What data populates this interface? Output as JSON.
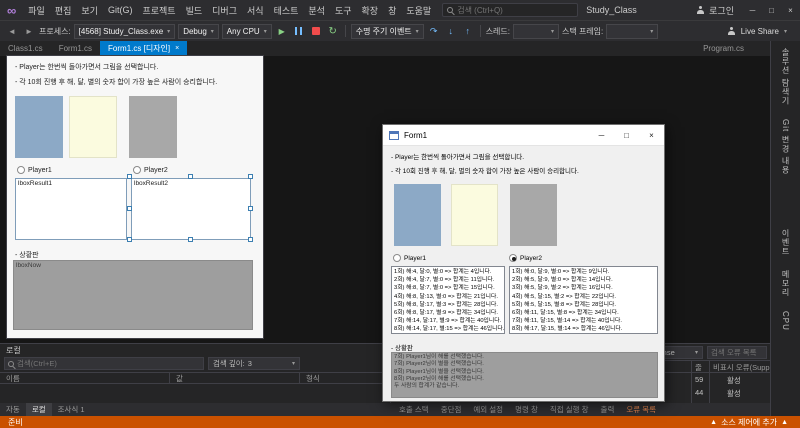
{
  "colors": {
    "accent": "#007acc",
    "status_bar": "#ca5100",
    "picture_blue": "#8ca9c6",
    "picture_cream": "#fbfbdf",
    "picture_gray": "#a8a8a8"
  },
  "titlebar": {
    "menus": [
      "파일",
      "편집",
      "보기",
      "Git(G)",
      "프로젝트",
      "빌드",
      "디버그",
      "서식",
      "테스트",
      "분석",
      "도구",
      "확장",
      "창",
      "도움말"
    ],
    "search_placeholder": "검색 (Ctrl+Q)",
    "solution": "Study_Class",
    "sign_in": "로그인",
    "minimize": "─",
    "maximize": "□",
    "close": "×"
  },
  "toolbar": {
    "back": "◄",
    "forward": "►",
    "process_label": "프로세스:",
    "process_value": "[4568] Study_Class.exe",
    "config": "Debug",
    "platform": "Any CPU",
    "continue_icon": "▶",
    "restart_icon": "↻",
    "lifecycle": "수명 주기 이벤트",
    "step_over": "↷",
    "step_into": "↓",
    "step_out": "↑",
    "thread_label": "스레드:",
    "frame_label": "스택 프레임:",
    "live_share": "Live Share",
    "caret": "▾"
  },
  "doc_tabs": {
    "tab1": "Class1.cs",
    "tab2": "Form1.cs",
    "tab3": "Form1.cs [디자인]",
    "tab4": "Program.cs",
    "close": "×"
  },
  "form": {
    "line1": "- Player는 한번씩 돌아가면서 그림을 선택합니다.",
    "line2": "- 각 10회 진행 후 해, 달, 별의 숫자 합이 가장 높은 사람이 승리합니다.",
    "radio1": "Player1",
    "radio2": "Player2",
    "board": "- 상황판"
  },
  "designer": {
    "lbox1": "lboxResult1",
    "lbox2": "lboxResult2",
    "lboxnow": "lboxNow"
  },
  "runtime": {
    "title": "Form1",
    "minimize": "─",
    "maximize": "□",
    "close": "×",
    "p1_lines": [
      "1회) 해:4, 달:0, 별:0 => 합계는 4입니다.",
      "2회) 해:4, 달:7, 별:0 => 합계는 11입니다.",
      "3회) 해:8, 달:7, 별:0 => 합계는 15입니다.",
      "4회) 해:8, 달:13, 별:0 => 합계는 21입니다.",
      "5회) 해:8, 달:17, 별:3 => 합계는 28입니다.",
      "6회) 해:8, 달:17, 별:9 => 합계는 34입니다.",
      "7회) 해:14, 달:17, 별:9 => 합계는 40입니다.",
      "8회) 해:14, 달:17, 별:15 => 합계는 46입니다."
    ],
    "p2_lines": [
      "1회) 해:0, 달:9, 별:0 => 합계는 9입니다.",
      "2회) 해:5, 달:9, 별:0 => 합계는 14입니다.",
      "3회) 해:5, 달:9, 별:2 => 합계는 16입니다.",
      "4회) 해:5, 달:15, 별:2 => 합계는 22입니다.",
      "5회) 해:5, 달:15, 별:8 => 합계는 28입니다.",
      "6회) 해:11, 달:15, 별:8 => 합계는 34입니다.",
      "7회) 해:11, 달:15, 별:14 => 합계는 40입니다.",
      "8회) 해:17, 달:15, 별:14 => 합계는 46입니다."
    ],
    "board_lines": [
      "7회) Player1님이 해를 선택했습니다.",
      "7회) Player2님이 별을 선택했습니다.",
      "8회) Player1님이 별을 선택했습니다.",
      "8회) Player2님이 해를 선택했습니다.",
      "",
      "두 사람의 합계가 같습니다."
    ]
  },
  "locals": {
    "title": "로컬",
    "search_placeholder": "검색(Ctrl+E)",
    "depth_label": "검색 깊이:",
    "depth_value": "3",
    "col_name": "이름",
    "col_value": "값",
    "col_type": "형식"
  },
  "errors": {
    "filter": "IntelliSense",
    "search_placeholder": "검색 오류 목록",
    "col_line": "줄",
    "col_suppression": "비표시 오류(Suppr...",
    "rows": [
      {
        "line": "59",
        "state": "활성"
      },
      {
        "line": "44",
        "state": "활성"
      }
    ]
  },
  "bottom_tabs": {
    "left": [
      "자동",
      "로컬",
      "조사식 1"
    ],
    "center": [
      "호출 스택",
      "중단점",
      "예외 설정",
      "명령 창",
      "직접 실행 창",
      "출력",
      "오류 목록"
    ]
  },
  "status": {
    "ready": "준비",
    "source_control": "소스 제어에 추가",
    "up_icon": "▲"
  },
  "sidebar": {
    "items": [
      "솔루션 탐색기",
      "Git 변경 내용",
      "이벤트",
      "메모리",
      "CPU"
    ]
  }
}
